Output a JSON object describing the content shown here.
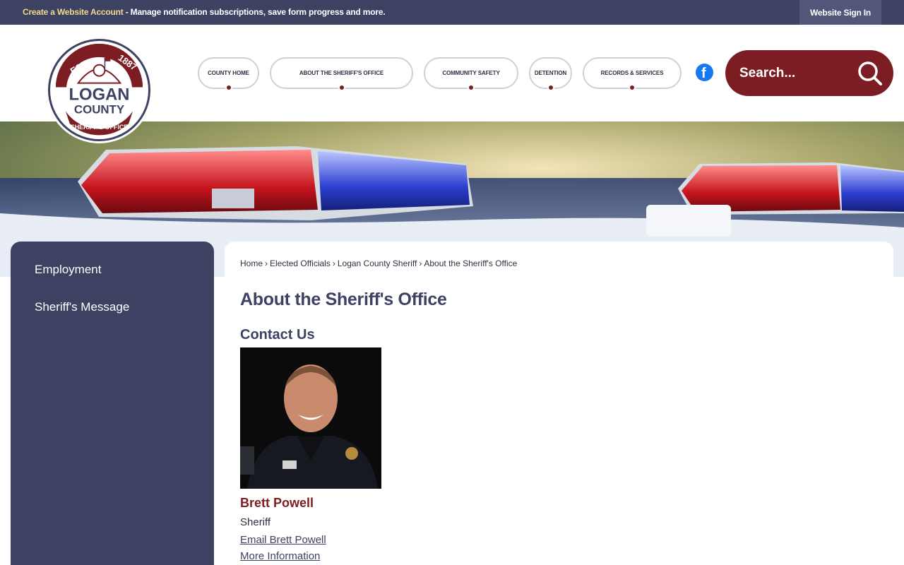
{
  "topbar": {
    "account_link": "Create a Website Account",
    "account_text": " - Manage notification subscriptions, save form progress and more.",
    "signin_label": "Website Sign In"
  },
  "logo": {
    "est": "EST.",
    "year": "1887",
    "line1": "LOGAN",
    "line2": "COUNTY",
    "ring_text": "SHERIFF'S OFFICE"
  },
  "nav": {
    "items": [
      {
        "label": "COUNTY HOME"
      },
      {
        "label": "ABOUT THE SHERIFF'S OFFICE"
      },
      {
        "label": "COMMUNITY SAFETY"
      },
      {
        "label": "DETENTION"
      },
      {
        "label": "RECORDS & SERVICES"
      }
    ]
  },
  "search": {
    "placeholder": "Search..."
  },
  "sidebar": {
    "items": [
      {
        "label": "Employment"
      },
      {
        "label": "Sheriff's Message"
      }
    ]
  },
  "breadcrumb": {
    "items": [
      "Home",
      "Elected Officials",
      "Logan County Sheriff",
      "About the Sheriff's Office"
    ],
    "separator": "›"
  },
  "main": {
    "title": "About the Sheriff's Office",
    "section_title": "Contact Us",
    "person": {
      "name": "Brett Powell",
      "role": "Sheriff",
      "email_link": "Email Brett Powell",
      "more_link": "More Information"
    }
  },
  "colors": {
    "navy": "#3d4263",
    "maroon": "#7b1d22",
    "gold": "#f1d98a",
    "facebook": "#1877f2"
  },
  "icons": {
    "facebook": "facebook-icon",
    "search": "search-icon"
  }
}
